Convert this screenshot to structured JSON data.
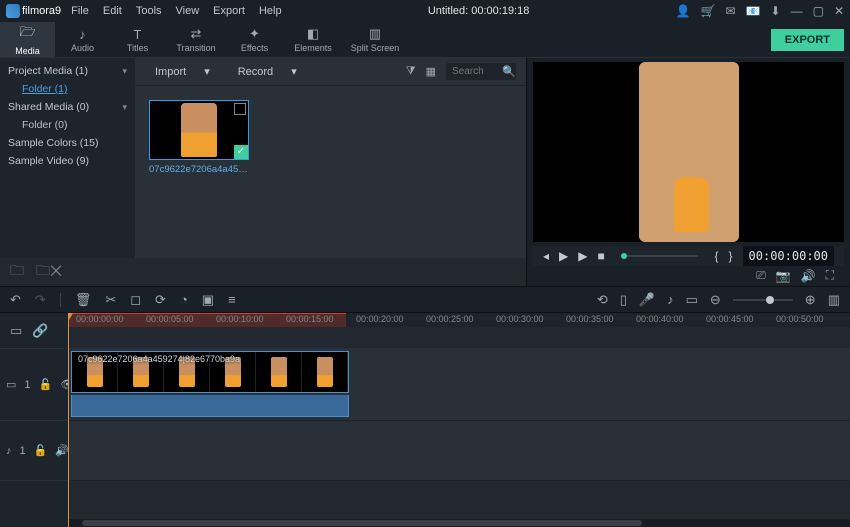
{
  "app": {
    "logo_text": "filmora9",
    "title": "Untitled:  00:00:19:18"
  },
  "menu": {
    "file": "File",
    "edit": "Edit",
    "tools": "Tools",
    "view": "View",
    "export": "Export",
    "help": "Help"
  },
  "titleIcons": {
    "user": "👤",
    "cart": "🛒",
    "mail": "✉",
    "msg": "📧",
    "dl": "⬇",
    "min": "—",
    "max": "▢",
    "close": "✕"
  },
  "tabs": {
    "media": {
      "icon": "🗁",
      "label": "Media"
    },
    "audio": {
      "icon": "♪",
      "label": "Audio"
    },
    "titles": {
      "icon": "T",
      "label": "Titles"
    },
    "transition": {
      "icon": "⇄",
      "label": "Transition"
    },
    "effects": {
      "icon": "✦",
      "label": "Effects"
    },
    "elements": {
      "icon": "◧",
      "label": "Elements"
    },
    "split": {
      "icon": "▥",
      "label": "Split Screen"
    }
  },
  "export_label": "EXPORT",
  "tree": {
    "project": "Project Media (1)",
    "project_folder": "Folder (1)",
    "shared": "Shared Media (0)",
    "shared_folder": "Folder (0)",
    "colors": "Sample Colors (15)",
    "video": "Sample Video (9)"
  },
  "mediaBar": {
    "import": "Import",
    "record": "Record",
    "search_placeholder": "Search"
  },
  "clip": {
    "name": "07c9622e7206a4a4592...",
    "full": "07c9622e7206a4a459274|82e6770ba9a"
  },
  "preview": {
    "timecode": "00:00:00:00",
    "brackets": {
      "in": "{",
      "out": "}"
    }
  },
  "ruler": {
    "ticks": [
      "00:00:00:00",
      "00:00:05:00",
      "00:00:10:00",
      "00:00:15:00",
      "00:00:20:00",
      "00:00:25:00",
      "00:00:30:00",
      "00:00:35:00",
      "00:00:40:00",
      "00:00:45:00",
      "00:00:50:00"
    ]
  },
  "tracks": {
    "video": "1",
    "audio": "1"
  }
}
